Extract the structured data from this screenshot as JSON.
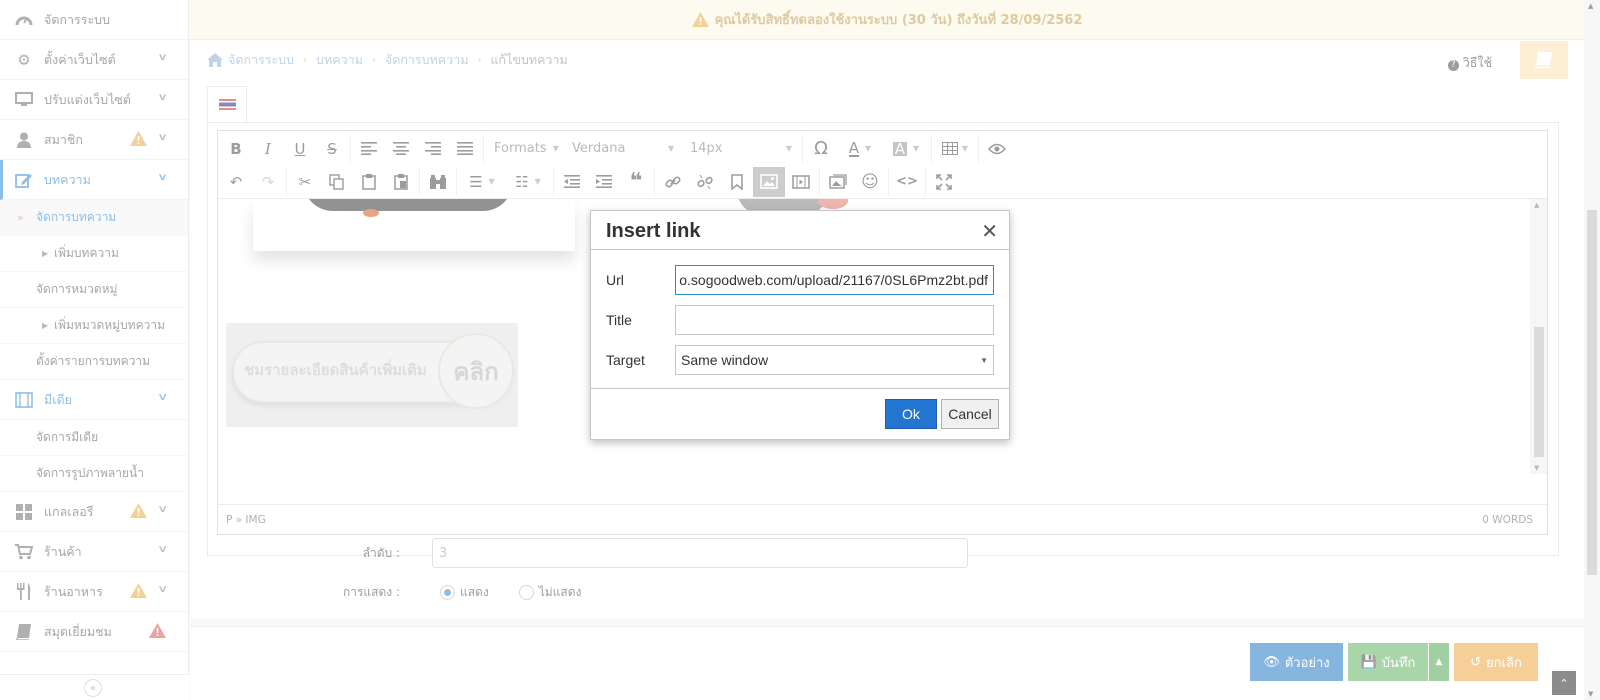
{
  "notice": {
    "text": "คุณได้รับสิทธิ์ทดลองใช้งานระบบ (30 วัน) ถึงวันที่ 28/09/2562"
  },
  "breadcrumb": [
    "จัดการระบบ",
    "บทความ",
    "จัดการบทความ",
    "แก้ไขบทความ"
  ],
  "howto_label": "วิธีใช้",
  "sidebar": {
    "items": [
      {
        "label": "จัดการระบบ",
        "icon": "dashboard-icon"
      },
      {
        "label": "ตั้งค่าเว็บไซต์",
        "icon": "gear-icon"
      },
      {
        "label": "ปรับแต่งเว็บไซต์",
        "icon": "monitor-icon"
      },
      {
        "label": "สมาชิก",
        "icon": "user-icon"
      },
      {
        "label": "บทความ",
        "icon": "edit-icon"
      },
      {
        "label": "มีเดีย",
        "icon": "film-icon"
      },
      {
        "label": "แกลเลอรี",
        "icon": "grid-icon"
      },
      {
        "label": "ร้านค้า",
        "icon": "cart-icon"
      },
      {
        "label": "ร้านอาหาร",
        "icon": "utensils-icon"
      },
      {
        "label": "สมุดเยี่ยมชม",
        "icon": "book-icon"
      }
    ],
    "article_sub": [
      "จัดการบทความ",
      "เพิ่มบทความ",
      "จัดการหมวดหมู่",
      "เพิ่มหมวดหมู่บทความ",
      "ตั้งค่ารายการบทความ"
    ],
    "media_sub": [
      "จัดการมีเดีย",
      "จัดการรูปภาพลายน้ำ"
    ]
  },
  "editor": {
    "toolbar": {
      "formats": "Formats",
      "font": "Verdana",
      "size": "14px"
    },
    "status_path": "P » IMG",
    "word_count": "0 WORDS",
    "banner_text": "ชมรายละเอียดสินค้าเพิ่มเติม",
    "banner_cta": "คลิก"
  },
  "form": {
    "order_label": "ลำดับ :",
    "order_value": "3",
    "display_label": "การแสดง :",
    "show": "แสดง",
    "hide": "ไม่แสดง"
  },
  "footer": {
    "preview": "ตัวอย่าง",
    "save": "บันทึก",
    "cancel": "ยกเลิก"
  },
  "dialog": {
    "title": "Insert link",
    "url_label": "Url",
    "url_value": "o.sogoodweb.com/upload/21167/0SL6Pmz2bt.pdf",
    "title_label": "Title",
    "title_value": "",
    "target_label": "Target",
    "target_value": "Same window",
    "ok": "Ok",
    "cancel": "Cancel"
  },
  "colors": {
    "accent": "#3b8fd4",
    "ok_button": "#2276d2",
    "warning": "#f0ad4e"
  }
}
